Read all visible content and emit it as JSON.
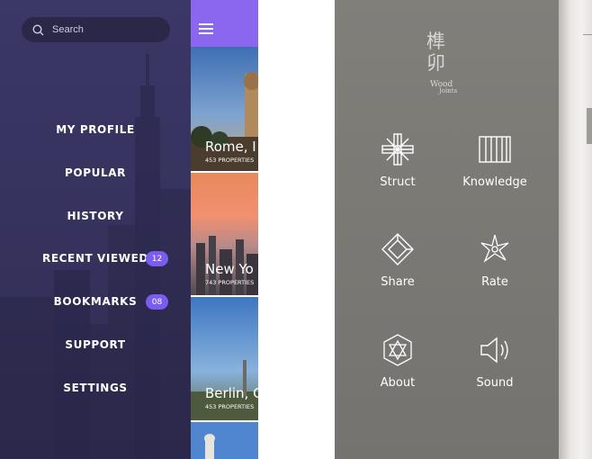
{
  "left_app": {
    "search": {
      "placeholder": "Search"
    },
    "menu": [
      {
        "label": "MY PROFILE"
      },
      {
        "label": "POPULAR"
      },
      {
        "label": "HISTORY"
      },
      {
        "label": "RECENT VIEWED",
        "badge": "12"
      },
      {
        "label": "BOOKMARKS",
        "badge": "08"
      },
      {
        "label": "SUPPORT"
      },
      {
        "label": "SETTINGS"
      }
    ],
    "cities": [
      {
        "name": "Rome, I",
        "count": "453 PROPERTIES"
      },
      {
        "name": "New Yo",
        "count": "743 PROPERTIES"
      },
      {
        "name": "Berlin, G",
        "count": "453 PROPERTIES"
      }
    ],
    "colors": {
      "accent": "#8b66ee",
      "badge": "#7b5cf0",
      "menu_bg": "#37335f"
    }
  },
  "right_app": {
    "logo": {
      "chars": "榫卯",
      "line1": "Wood",
      "line2": "Joints"
    },
    "buttons": [
      {
        "label": "Struct",
        "icon": "struct-icon"
      },
      {
        "label": "Knowledge",
        "icon": "knowledge-icon"
      },
      {
        "label": "Share",
        "icon": "share-icon"
      },
      {
        "label": "Rate",
        "icon": "rate-icon"
      },
      {
        "label": "About",
        "icon": "about-icon"
      },
      {
        "label": "Sound",
        "icon": "sound-icon"
      }
    ],
    "colors": {
      "panel": "#7c7a75"
    }
  }
}
